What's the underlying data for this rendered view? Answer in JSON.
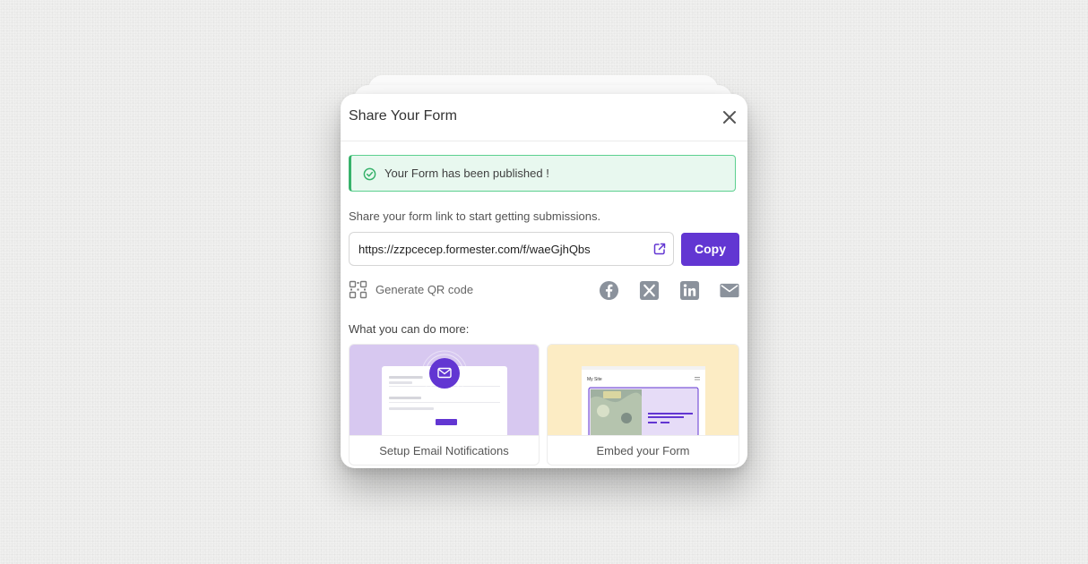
{
  "modal": {
    "title": "Share Your Form",
    "close_icon": "close-icon"
  },
  "banner": {
    "icon": "check-circle-icon",
    "text": "Your Form has been published !",
    "color": "#37b26b"
  },
  "share": {
    "description": "Share your form link to start getting submissions.",
    "url": "https://zzpcecep.formester.com/f/waeGjhQbs",
    "open_icon": "external-link-icon",
    "copy_label": "Copy",
    "accent": "#6236d2"
  },
  "qr": {
    "icon": "qr-code-icon",
    "label": "Generate QR code"
  },
  "social_icons": [
    "facebook-icon",
    "x-icon",
    "linkedin-icon",
    "email-icon"
  ],
  "more": {
    "heading": "What you can do more:",
    "cards": [
      {
        "label": "Setup Email Notifications",
        "color": "#d7c8f0",
        "thumb_text": ""
      },
      {
        "label": "Embed your Form",
        "color": "#fcecc4",
        "thumb_text": "My Site"
      }
    ]
  }
}
